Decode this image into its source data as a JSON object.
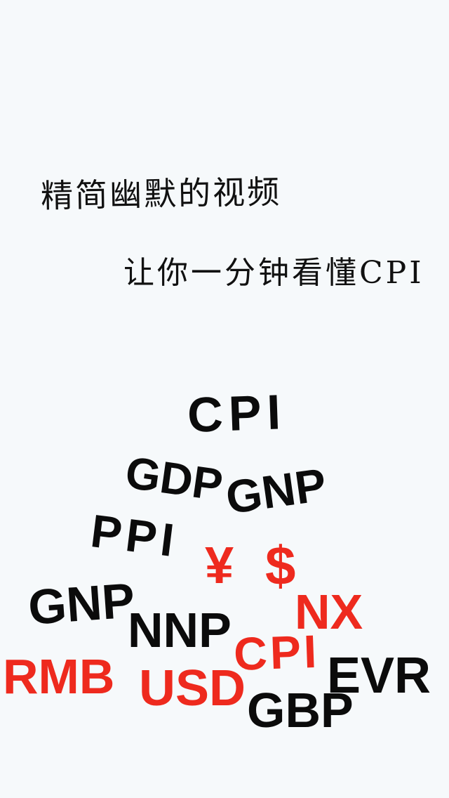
{
  "caption": {
    "line1": "精简幽默的视频",
    "line2": "让你一分钟看懂CPI"
  },
  "colors": {
    "background": "#f6f9fb",
    "black_text": "#0b0b0b",
    "red_text": "#ee2a1e"
  },
  "word_cloud": [
    {
      "text": "CPI",
      "color": "black"
    },
    {
      "text": "GDP",
      "color": "black"
    },
    {
      "text": "GNP",
      "color": "black"
    },
    {
      "text": "PPI",
      "color": "black"
    },
    {
      "text": "¥",
      "color": "red"
    },
    {
      "text": "$",
      "color": "red"
    },
    {
      "text": "GNP",
      "color": "black"
    },
    {
      "text": "NX",
      "color": "red"
    },
    {
      "text": "NNP",
      "color": "black"
    },
    {
      "text": "CPI",
      "color": "red"
    },
    {
      "text": "RMB",
      "color": "red"
    },
    {
      "text": "USD",
      "color": "red"
    },
    {
      "text": "EVR",
      "color": "black"
    },
    {
      "text": "GBP",
      "color": "black"
    }
  ]
}
